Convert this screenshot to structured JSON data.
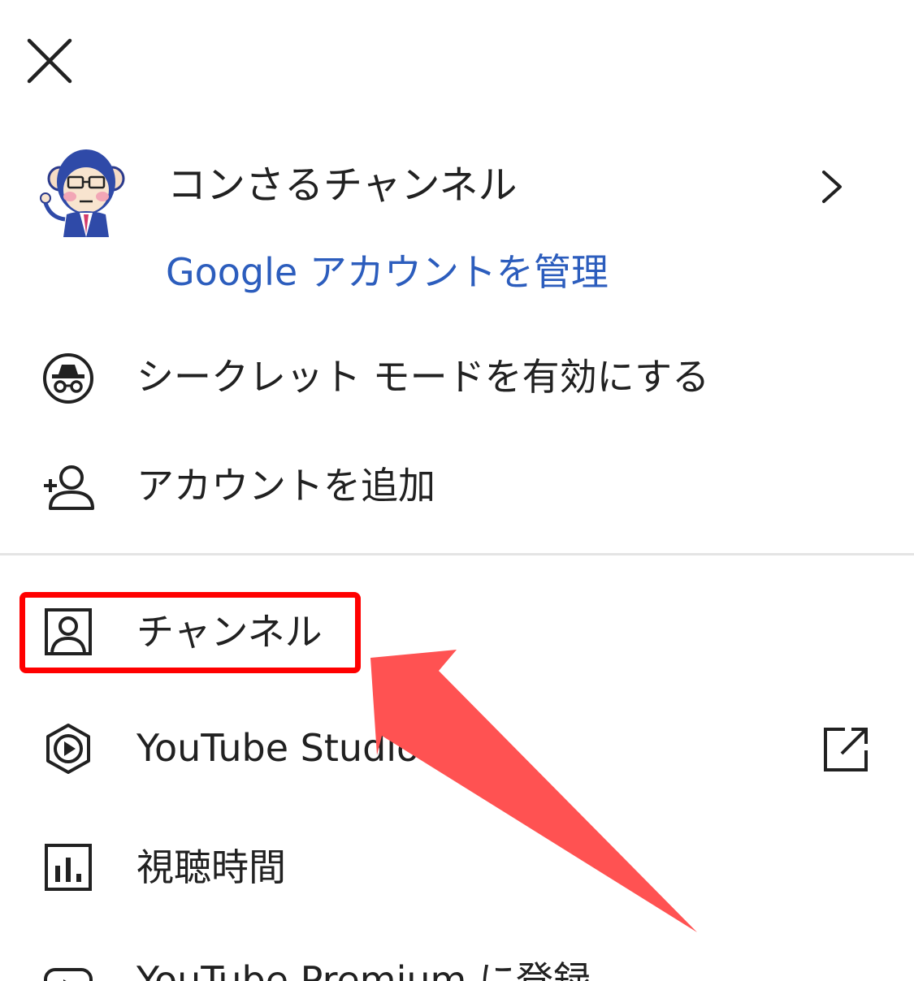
{
  "header": {
    "close_icon": "close-icon"
  },
  "account": {
    "name": "コンさるチャンネル",
    "manage_link": "Google アカウントを管理",
    "chevron_icon": "chevron-right-icon"
  },
  "menu_top": [
    {
      "label": "シークレット モードを有効にする",
      "icon": "incognito-icon"
    },
    {
      "label": "アカウントを追加",
      "icon": "add-account-icon"
    }
  ],
  "menu_main": [
    {
      "label": "チャンネル",
      "icon": "channel-icon"
    },
    {
      "label": "YouTube Studio",
      "icon": "youtube-studio-icon",
      "trailing_icon": "external-link-icon"
    },
    {
      "label": "視聴時間",
      "icon": "watch-time-icon"
    },
    {
      "label": "YouTube Premium に登録",
      "icon": "youtube-premium-icon"
    }
  ],
  "colors": {
    "link": "#2c5dbd",
    "highlight_border": "#ff0000",
    "arrow": "#ff5252",
    "divider": "#e4e4e4"
  }
}
